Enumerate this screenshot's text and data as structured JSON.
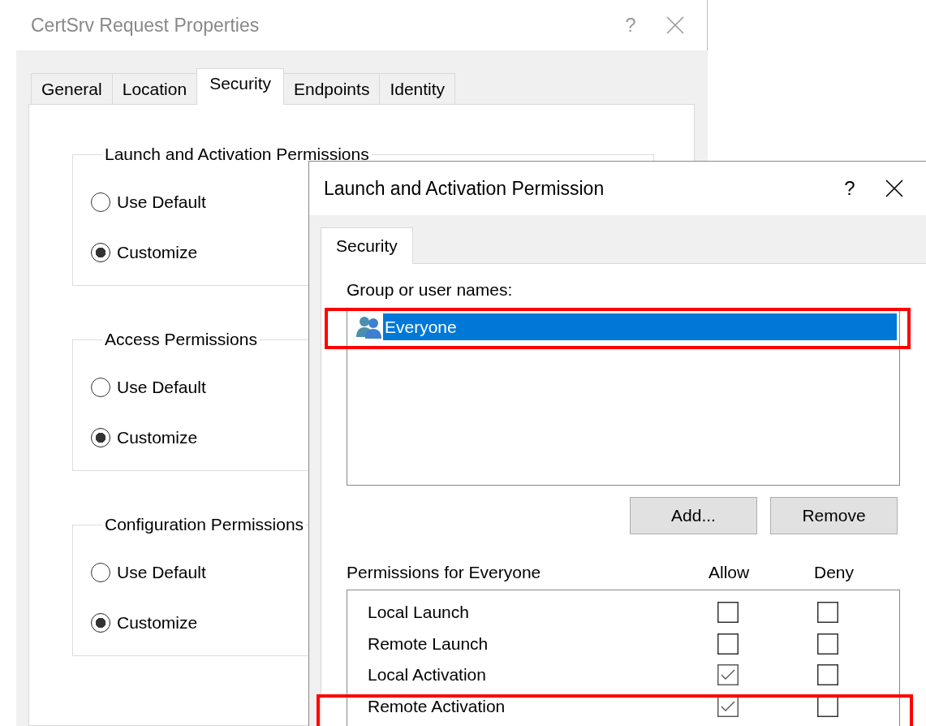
{
  "properties_window": {
    "title": "CertSrv Request Properties",
    "help": "?",
    "tabs": [
      {
        "label": "General",
        "selected": false
      },
      {
        "label": "Location",
        "selected": false
      },
      {
        "label": "Security",
        "selected": true
      },
      {
        "label": "Endpoints",
        "selected": false
      },
      {
        "label": "Identity",
        "selected": false
      }
    ],
    "groups": [
      {
        "title": "Launch and Activation Permissions",
        "options": [
          {
            "label": "Use Default",
            "selected": false
          },
          {
            "label": "Customize",
            "selected": true
          }
        ]
      },
      {
        "title": "Access Permissions",
        "options": [
          {
            "label": "Use Default",
            "selected": false
          },
          {
            "label": "Customize",
            "selected": true
          }
        ]
      },
      {
        "title": "Configuration Permissions",
        "options": [
          {
            "label": "Use Default",
            "selected": false
          },
          {
            "label": "Customize",
            "selected": true
          }
        ]
      }
    ]
  },
  "permission_dialog": {
    "title": "Launch and Activation Permission",
    "help": "?",
    "tabs": [
      {
        "label": "Security",
        "selected": true
      }
    ],
    "users_label": "Group or user names:",
    "users": [
      {
        "name": "Everyone",
        "selected": true,
        "highlighted": true
      }
    ],
    "buttons": [
      "Add...",
      "Remove"
    ],
    "permissions_label": "Permissions for Everyone",
    "columns": [
      "Allow",
      "Deny"
    ],
    "permissions": [
      {
        "name": "Local Launch",
        "allow": false,
        "deny": false,
        "highlighted": false
      },
      {
        "name": "Remote Launch",
        "allow": false,
        "deny": false,
        "highlighted": false
      },
      {
        "name": "Local Activation",
        "allow": true,
        "deny": false,
        "highlighted": false
      },
      {
        "name": "Remote Activation",
        "allow": true,
        "deny": false,
        "highlighted": true
      }
    ]
  }
}
